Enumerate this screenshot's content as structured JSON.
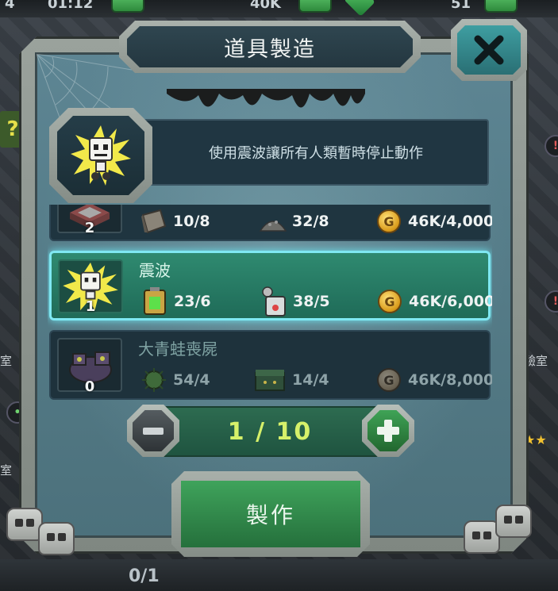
{
  "hud": {
    "left_count": "4",
    "timer": "01:12",
    "resource_amount": "40K",
    "gem_count": "51"
  },
  "background": {
    "left_room_label_1": "室",
    "left_room_label_2": "室",
    "right_room_label": "驗室",
    "bottom_counter": "0/1"
  },
  "dialog": {
    "title": "道具製造",
    "close_icon": "close-x-icon",
    "description": "使用震波讓所有人類暫時停止動作",
    "selected_item_icon": "shockwave-robot-icon",
    "items": [
      {
        "name": "",
        "icon": "box-trap-icon",
        "count": "2",
        "materials": [
          {
            "icon": "metal-plate-icon",
            "amount": "10/8"
          },
          {
            "icon": "scrap-pile-icon",
            "amount": "32/8"
          },
          {
            "icon": "gold-coin-icon",
            "amount": "46K/4,000"
          }
        ],
        "selected": false,
        "dim": false
      },
      {
        "name": "震波",
        "icon": "shockwave-robot-icon",
        "count": "1",
        "materials": [
          {
            "icon": "battery-icon",
            "amount": "23/6"
          },
          {
            "icon": "radio-device-icon",
            "amount": "38/5"
          },
          {
            "icon": "gold-coin-icon",
            "amount": "46K/6,000"
          }
        ],
        "selected": true,
        "dim": false
      },
      {
        "name": "大青蛙喪屍",
        "icon": "frog-zombie-icon",
        "count": "0",
        "materials": [
          {
            "icon": "virus-icon",
            "amount": "54/4"
          },
          {
            "icon": "green-crate-icon",
            "amount": "14/4"
          },
          {
            "icon": "gold-coin-icon",
            "amount": "46K/8,000"
          }
        ],
        "selected": false,
        "dim": true
      }
    ],
    "coin_letter": "G",
    "quantity": "1 / 10",
    "make_label": "製作"
  },
  "colors": {
    "panel": "#5d8593",
    "selected_row": "#2f8a70",
    "selected_glow": "#7fe8f2",
    "quantity_text": "#d6f06a",
    "make_button": "#3fa35b"
  }
}
